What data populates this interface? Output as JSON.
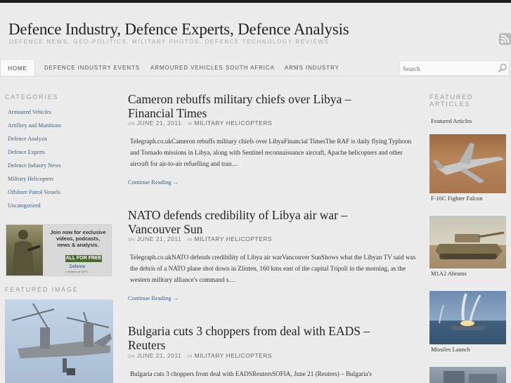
{
  "site": {
    "title": "Defence Industry, Defence Experts, Defence Analysis",
    "description": "DEFENCE NEWS, GEO-POLITICS, MILITARY PHOTOS, DEFENCE TECHNOLOGY REVIEWS"
  },
  "nav": {
    "home": "HOME",
    "items": [
      "DEFENCE INDUSTRY EVENTS",
      "ARMOURED VEHICLES SOUTH AFRICA",
      "ARMS INDUSTRY"
    ]
  },
  "search": {
    "placeholder": "Search"
  },
  "sidebar_left": {
    "categories_title": "CATEGORIES",
    "categories": [
      "Armoured Vehicles",
      "Artillery and Munitions",
      "Defence Analysis",
      "Defence Experts",
      "Defence Industry News",
      "Military Helicopters",
      "Offshore Patrol Vessels",
      "Uncategorized"
    ],
    "ad": {
      "line1": "Join now for exclusive",
      "line2": "videos, podcasts,",
      "line3": "news & analysis.",
      "cta": "ALL FOR FREE",
      "brand": "Defence",
      "brand_sub": "a division of IQPC"
    },
    "featured_image_title": "FEATURED IMAGE"
  },
  "posts": [
    {
      "title_line1": "Cameron rebuffs military chiefs over Libya –",
      "title_line2": "Financial Times",
      "on": "ON",
      "date": "JUNE 21, 2011",
      "sep": "·",
      "in": "IN",
      "category": "MILITARY HELICOPTERS",
      "excerpt": "Telegraph.co.ukCameron rebuffs military chiefs over LibyaFinancial TimesThe RAF is daily flying Typhoon and Tornado missions in Libya, along with Sentinel reconnaissance aircraft, Apache helicopters and other aircraft for air-to-air refuelling and tran…",
      "continue": "Continue Reading →"
    },
    {
      "title_line1": "NATO defends credibility of Libya air war –",
      "title_line2": "Vancouver Sun",
      "on": "ON",
      "date": "JUNE 21, 2011",
      "sep": "·",
      "in": "IN",
      "category": "MILITARY HELICOPTERS",
      "excerpt": "Telegraph.co.ukNATO defends credibility of Libya air warVancouver SunShows what the Libyan TV said was the debris of a NATO plane shot down in Zlinten, 160 kms east of the capital Tripoli in the morning, as the western military alliance's command s…",
      "continue": "Continue Reading →"
    },
    {
      "title_line1": "Bulgaria cuts 3 choppers from deal with EADS –",
      "title_line2": "Reuters",
      "on": "ON",
      "date": "JUNE 21, 2011",
      "sep": "·",
      "in": "IN",
      "category": "MILITARY HELICOPTERS",
      "excerpt": "Bulgaria cuts 3 choppers from deal with EADSReutersSOFIA, June 21 (Reuters) – Bulgaria's"
    }
  ],
  "sidebar_right": {
    "title_line1": "FEATURED",
    "title_line2": "ARTICLES",
    "heading": "Featured Articles",
    "items": [
      "F-16C Fighter Falcon",
      "M1A2 Abrams",
      "Missiles Launch"
    ]
  },
  "colors": {
    "background": "#ececec",
    "link": "#3a5e86",
    "muted": "#9a9a9a",
    "topbar": "#1c1c1c"
  }
}
